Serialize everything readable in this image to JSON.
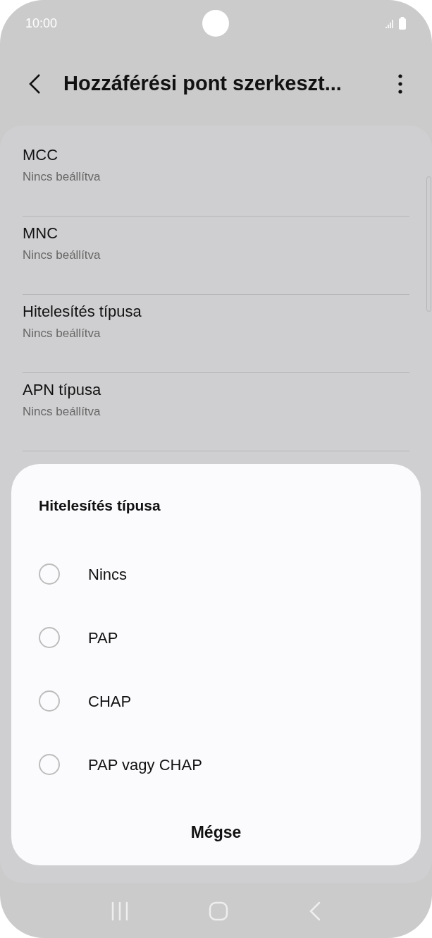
{
  "status_bar": {
    "time": "10:00"
  },
  "header": {
    "title": "Hozzáférési pont szerkeszt..."
  },
  "settings": [
    {
      "label": "MCC",
      "value": "Nincs beállítva"
    },
    {
      "label": "MNC",
      "value": "Nincs beállítva"
    },
    {
      "label": "Hitelesítés típusa",
      "value": "Nincs beállítva"
    },
    {
      "label": "APN típusa",
      "value": "Nincs beállítva"
    }
  ],
  "dialog": {
    "title": "Hitelesítés típusa",
    "options": [
      {
        "label": "Nincs",
        "selected": false
      },
      {
        "label": "PAP",
        "selected": false
      },
      {
        "label": "CHAP",
        "selected": false
      },
      {
        "label": "PAP vagy CHAP",
        "selected": false
      }
    ],
    "cancel": "Mégse"
  }
}
